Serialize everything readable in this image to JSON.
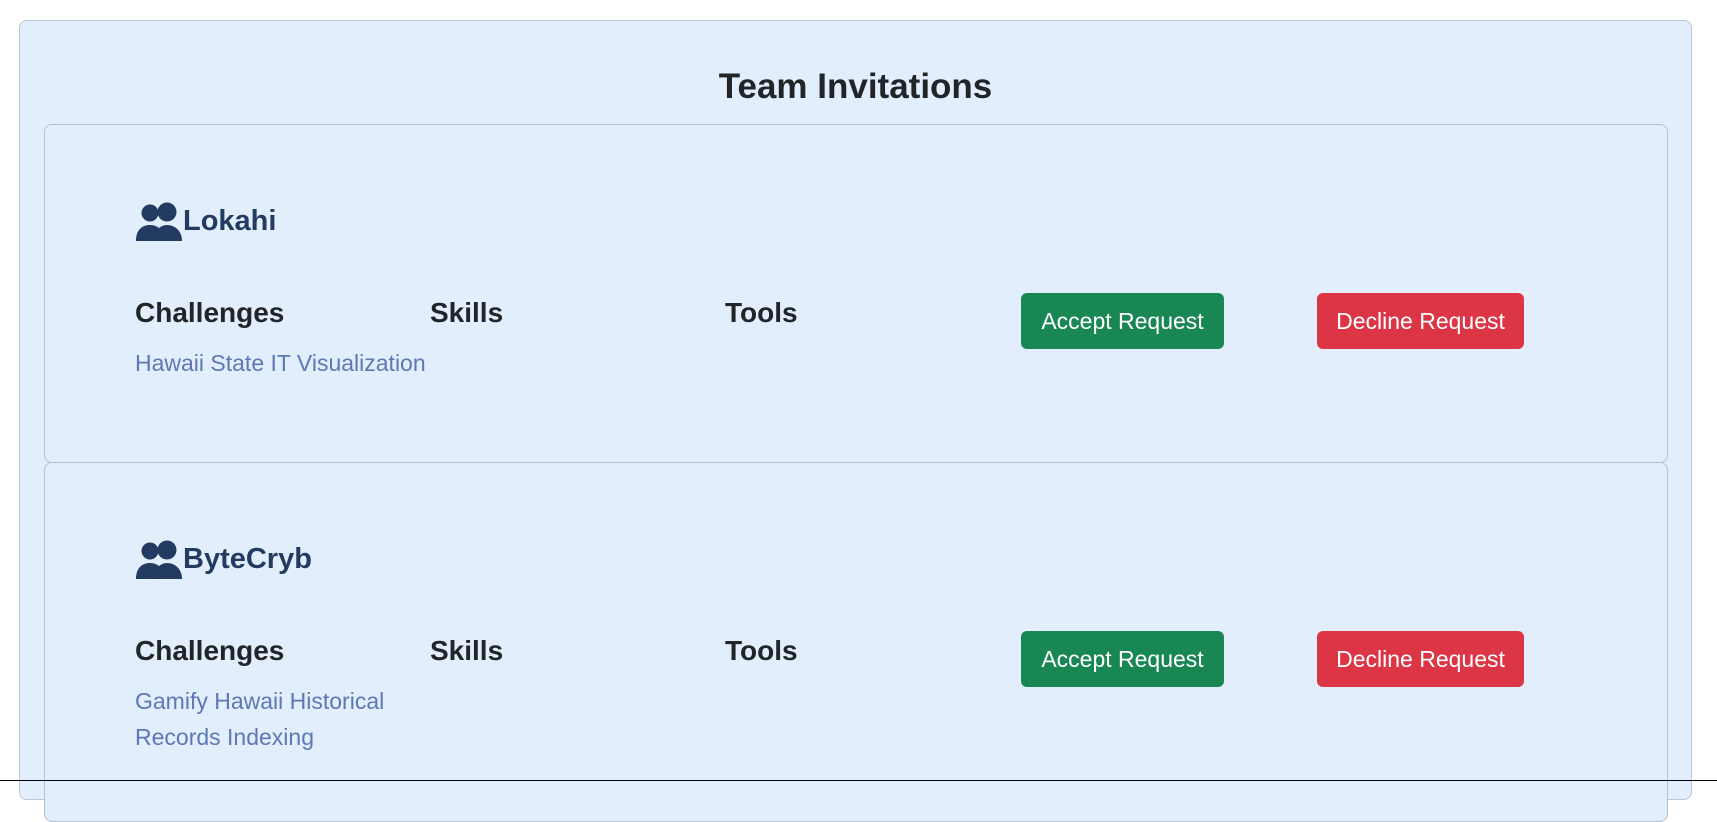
{
  "page": {
    "title": "Team Invitations"
  },
  "columns": {
    "challenges": "Challenges",
    "skills": "Skills",
    "tools": "Tools"
  },
  "actions": {
    "accept_label": "Accept Request",
    "decline_label": "Decline Request"
  },
  "invitations": [
    {
      "team_name": "Lokahi",
      "icon": "users-icon",
      "challenges": [
        "Hawaii State IT Visualization"
      ],
      "skills": [],
      "tools": []
    },
    {
      "team_name": "ByteCryb",
      "icon": "users-icon",
      "challenges": [
        "Gamify Hawaii Historical Records Indexing"
      ],
      "skills": [],
      "tools": []
    }
  ],
  "colors": {
    "background": "#e2eefc",
    "accept": "#198754",
    "decline": "#dc3545",
    "link": "#5d78b4",
    "team_name": "#243b61"
  }
}
